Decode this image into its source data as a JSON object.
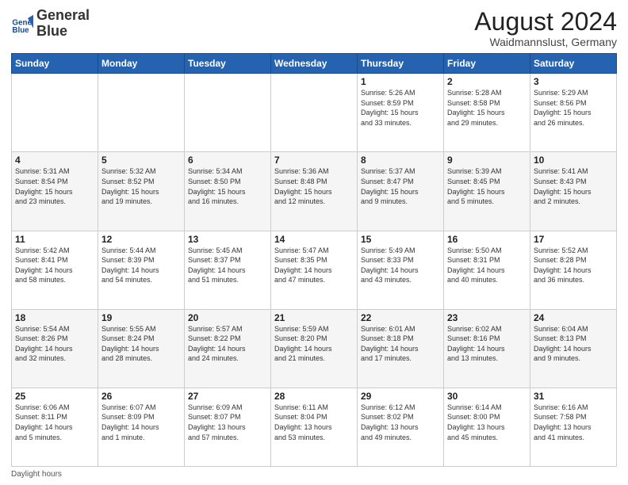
{
  "header": {
    "logo_line1": "General",
    "logo_line2": "Blue",
    "month_title": "August 2024",
    "location": "Waidmannslust, Germany"
  },
  "days_of_week": [
    "Sunday",
    "Monday",
    "Tuesday",
    "Wednesday",
    "Thursday",
    "Friday",
    "Saturday"
  ],
  "footer": {
    "note": "Daylight hours"
  },
  "weeks": [
    [
      {
        "day": "",
        "info": ""
      },
      {
        "day": "",
        "info": ""
      },
      {
        "day": "",
        "info": ""
      },
      {
        "day": "",
        "info": ""
      },
      {
        "day": "1",
        "info": "Sunrise: 5:26 AM\nSunset: 8:59 PM\nDaylight: 15 hours\nand 33 minutes."
      },
      {
        "day": "2",
        "info": "Sunrise: 5:28 AM\nSunset: 8:58 PM\nDaylight: 15 hours\nand 29 minutes."
      },
      {
        "day": "3",
        "info": "Sunrise: 5:29 AM\nSunset: 8:56 PM\nDaylight: 15 hours\nand 26 minutes."
      }
    ],
    [
      {
        "day": "4",
        "info": "Sunrise: 5:31 AM\nSunset: 8:54 PM\nDaylight: 15 hours\nand 23 minutes."
      },
      {
        "day": "5",
        "info": "Sunrise: 5:32 AM\nSunset: 8:52 PM\nDaylight: 15 hours\nand 19 minutes."
      },
      {
        "day": "6",
        "info": "Sunrise: 5:34 AM\nSunset: 8:50 PM\nDaylight: 15 hours\nand 16 minutes."
      },
      {
        "day": "7",
        "info": "Sunrise: 5:36 AM\nSunset: 8:48 PM\nDaylight: 15 hours\nand 12 minutes."
      },
      {
        "day": "8",
        "info": "Sunrise: 5:37 AM\nSunset: 8:47 PM\nDaylight: 15 hours\nand 9 minutes."
      },
      {
        "day": "9",
        "info": "Sunrise: 5:39 AM\nSunset: 8:45 PM\nDaylight: 15 hours\nand 5 minutes."
      },
      {
        "day": "10",
        "info": "Sunrise: 5:41 AM\nSunset: 8:43 PM\nDaylight: 15 hours\nand 2 minutes."
      }
    ],
    [
      {
        "day": "11",
        "info": "Sunrise: 5:42 AM\nSunset: 8:41 PM\nDaylight: 14 hours\nand 58 minutes."
      },
      {
        "day": "12",
        "info": "Sunrise: 5:44 AM\nSunset: 8:39 PM\nDaylight: 14 hours\nand 54 minutes."
      },
      {
        "day": "13",
        "info": "Sunrise: 5:45 AM\nSunset: 8:37 PM\nDaylight: 14 hours\nand 51 minutes."
      },
      {
        "day": "14",
        "info": "Sunrise: 5:47 AM\nSunset: 8:35 PM\nDaylight: 14 hours\nand 47 minutes."
      },
      {
        "day": "15",
        "info": "Sunrise: 5:49 AM\nSunset: 8:33 PM\nDaylight: 14 hours\nand 43 minutes."
      },
      {
        "day": "16",
        "info": "Sunrise: 5:50 AM\nSunset: 8:31 PM\nDaylight: 14 hours\nand 40 minutes."
      },
      {
        "day": "17",
        "info": "Sunrise: 5:52 AM\nSunset: 8:28 PM\nDaylight: 14 hours\nand 36 minutes."
      }
    ],
    [
      {
        "day": "18",
        "info": "Sunrise: 5:54 AM\nSunset: 8:26 PM\nDaylight: 14 hours\nand 32 minutes."
      },
      {
        "day": "19",
        "info": "Sunrise: 5:55 AM\nSunset: 8:24 PM\nDaylight: 14 hours\nand 28 minutes."
      },
      {
        "day": "20",
        "info": "Sunrise: 5:57 AM\nSunset: 8:22 PM\nDaylight: 14 hours\nand 24 minutes."
      },
      {
        "day": "21",
        "info": "Sunrise: 5:59 AM\nSunset: 8:20 PM\nDaylight: 14 hours\nand 21 minutes."
      },
      {
        "day": "22",
        "info": "Sunrise: 6:01 AM\nSunset: 8:18 PM\nDaylight: 14 hours\nand 17 minutes."
      },
      {
        "day": "23",
        "info": "Sunrise: 6:02 AM\nSunset: 8:16 PM\nDaylight: 14 hours\nand 13 minutes."
      },
      {
        "day": "24",
        "info": "Sunrise: 6:04 AM\nSunset: 8:13 PM\nDaylight: 14 hours\nand 9 minutes."
      }
    ],
    [
      {
        "day": "25",
        "info": "Sunrise: 6:06 AM\nSunset: 8:11 PM\nDaylight: 14 hours\nand 5 minutes."
      },
      {
        "day": "26",
        "info": "Sunrise: 6:07 AM\nSunset: 8:09 PM\nDaylight: 14 hours\nand 1 minute."
      },
      {
        "day": "27",
        "info": "Sunrise: 6:09 AM\nSunset: 8:07 PM\nDaylight: 13 hours\nand 57 minutes."
      },
      {
        "day": "28",
        "info": "Sunrise: 6:11 AM\nSunset: 8:04 PM\nDaylight: 13 hours\nand 53 minutes."
      },
      {
        "day": "29",
        "info": "Sunrise: 6:12 AM\nSunset: 8:02 PM\nDaylight: 13 hours\nand 49 minutes."
      },
      {
        "day": "30",
        "info": "Sunrise: 6:14 AM\nSunset: 8:00 PM\nDaylight: 13 hours\nand 45 minutes."
      },
      {
        "day": "31",
        "info": "Sunrise: 6:16 AM\nSunset: 7:58 PM\nDaylight: 13 hours\nand 41 minutes."
      }
    ]
  ]
}
